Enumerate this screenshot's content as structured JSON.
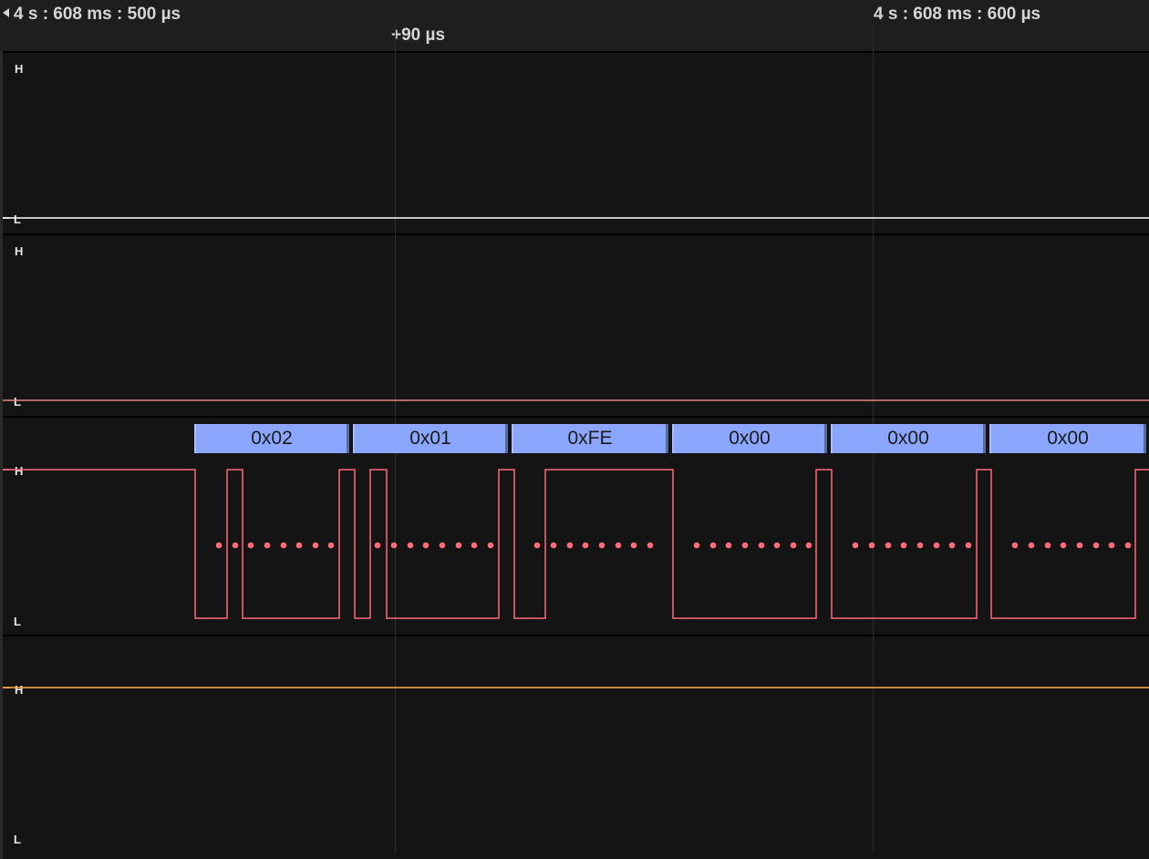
{
  "ruler": {
    "start_time": "4 s : 608 ms : 500 µs",
    "end_time": "4 s : 608 ms : 600 µs",
    "cursor_delta": "+90 µs"
  },
  "level_labels": {
    "high": "H",
    "low": "L"
  },
  "colors": {
    "channel_1": "#ffffff",
    "channel_2": "#e88a7a",
    "channel_3": "#ff6b7a",
    "channel_4": "#ffae4a",
    "frame_box": "#8aa6ff"
  },
  "channels": [
    {
      "state": "low"
    },
    {
      "state": "low"
    },
    {
      "state": "serial",
      "frames": [
        "0x02",
        "0x01",
        "0xFE",
        "0x00",
        "0x00",
        "0x00"
      ]
    },
    {
      "state": "high"
    }
  ]
}
